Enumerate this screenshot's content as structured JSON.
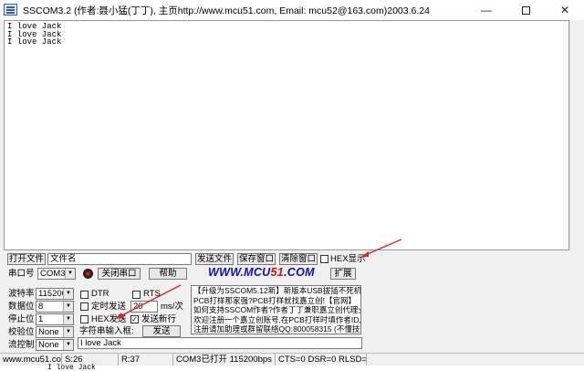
{
  "window": {
    "title": "SSCOM3.2 (作者:聂小猛(丁丁), 主页http://www.mcu51.com,  Email: mcu52@163.com)2003.6.24",
    "minimize": "—",
    "close": "✕"
  },
  "receive": {
    "lines": [
      "I love Jack",
      "I love Jack",
      "I love Jack"
    ]
  },
  "row1": {
    "open_file": "打开文件",
    "file_name": "文件名",
    "send_file": "发送文件",
    "save_window": "保存窗口",
    "clear_window": "清除窗口",
    "hex_display": "HEX显示"
  },
  "row2": {
    "port_label": "串口号",
    "port_value": "COM3",
    "close_port": "关闭串口",
    "help": "帮助",
    "logo_a": "WWW.MCU",
    "logo_b": "51",
    "logo_c": ".COM",
    "expand": "扩展"
  },
  "settings": {
    "baud_label": "波特率",
    "baud_value": "115200",
    "data_label": "数据位",
    "data_value": "8",
    "stop_label": "停止位",
    "stop_value": "1",
    "parity_label": "校验位",
    "parity_value": "None",
    "flow_label": "流控制",
    "flow_value": "None"
  },
  "controls": {
    "dtr": "DTR",
    "rts": "RTS",
    "timed_send": "定时发送",
    "interval": "20",
    "interval_unit": "ms/次",
    "hex_send": "HEX发送",
    "send_newline": "发送新行",
    "newline_check": "✓",
    "input_label": "字符串输入框:",
    "send_button": "发送",
    "input_value": "I love Jack"
  },
  "ad": {
    "lines": [
      "【升级为SSCOM5.12新】新版本USB拔插不死机!",
      "PCB打样那家强?PCB打样就找嘉立创!【官网】",
      "如何支持SSCOM作者?作者丁丁兼职嘉立创代理业务",
      "欢迎注册一个嘉立创账号,在PCB打样时填作者ID,可得有多少",
      "注册请加助理或群留联络QQ:800058315 (不懂技术)"
    ]
  },
  "status": {
    "site": "www.mcu51.cor",
    "sent": "S:26",
    "received": "R:37",
    "port_state": "COM3已打开  115200bps",
    "signals": "CTS=0 DSR=0 RLSD=0"
  },
  "below_text": "I love Jack",
  "colors": {
    "annotation_arrow": "#d62828",
    "logo_blue": "#1010c0",
    "logo_red": "#d01010"
  }
}
